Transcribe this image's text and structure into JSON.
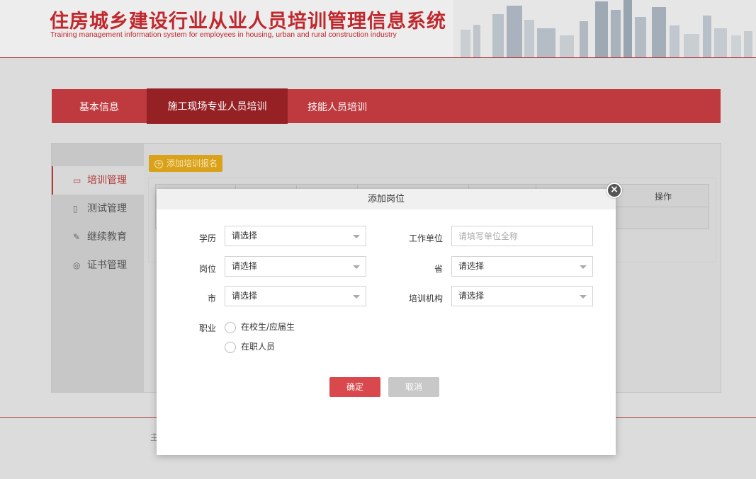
{
  "header": {
    "title_cn": "住房城乡建设行业从业人员培训管理信息系统",
    "title_en": "Training management information system for employees in housing, urban and rural construction industry"
  },
  "tabs": [
    {
      "label": "基本信息",
      "active": false
    },
    {
      "label": "施工现场专业人员培训",
      "active": true
    },
    {
      "label": "技能人员培训",
      "active": false
    }
  ],
  "sidebar": {
    "items": [
      {
        "label": "培训管理",
        "icon": "chat-icon",
        "active": true
      },
      {
        "label": "测试管理",
        "icon": "document-icon",
        "active": false
      },
      {
        "label": "继续教育",
        "icon": "edit-icon",
        "active": false
      },
      {
        "label": "证书管理",
        "icon": "badge-icon",
        "active": false
      }
    ]
  },
  "main": {
    "add_button_label": "添加培训报名",
    "table_header_operation": "操作"
  },
  "footer": {
    "text": "主"
  },
  "modal": {
    "title": "添加岗位",
    "fields": {
      "education_label": "学历",
      "education_value": "请选择",
      "employer_label": "工作单位",
      "employer_placeholder": "请填写单位全称",
      "position_label": "岗位",
      "position_value": "请选择",
      "province_label": "省",
      "province_value": "请选择",
      "city_label": "市",
      "city_value": "请选择",
      "institution_label": "培训机构",
      "institution_value": "请选择",
      "occupation_label": "职业",
      "occupation_options": [
        "在校生/应届生",
        "在职人员"
      ]
    },
    "confirm_label": "确定",
    "cancel_label": "取消",
    "close_symbol": "×"
  },
  "colors": {
    "brand_red": "#bf3a3e",
    "active_tab": "#962125",
    "confirm_button": "#d9484d",
    "add_button": "#d9a21a"
  }
}
